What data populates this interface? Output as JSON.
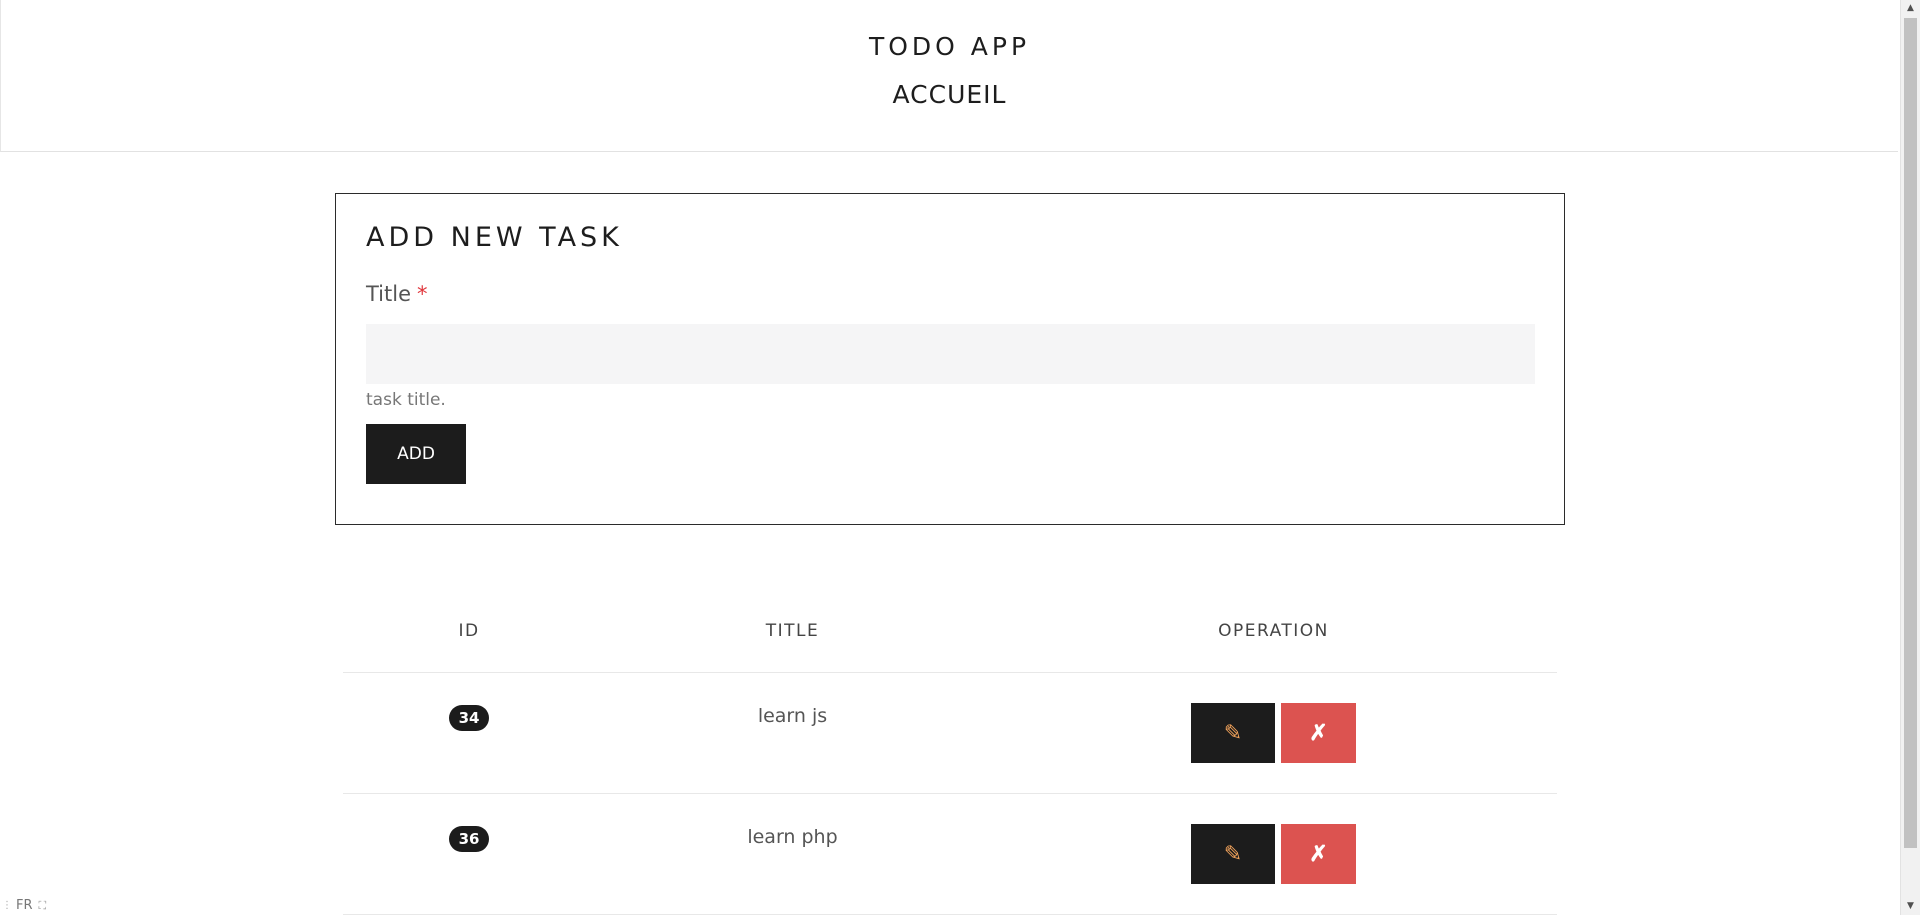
{
  "header": {
    "app_title": "TODO APP",
    "nav_home": "ACCUEIL"
  },
  "form": {
    "heading": "ADD NEW TASK",
    "title_label": "Title",
    "required_mark": "*",
    "title_value": "",
    "help_text": "task title.",
    "add_label": "ADD"
  },
  "table": {
    "headers": [
      "ID",
      "TITLE",
      "OPERATION"
    ],
    "rows": [
      {
        "id": "34",
        "title": "learn js"
      },
      {
        "id": "36",
        "title": "learn php"
      }
    ]
  },
  "icons": {
    "edit": "pencil-icon",
    "delete": "cross-icon"
  },
  "colors": {
    "dark": "#1c1c1c",
    "danger": "#dc5350",
    "required": "#e0363c",
    "edit_icon": "#f2a35b"
  },
  "lang_widget": {
    "label": "FR"
  }
}
